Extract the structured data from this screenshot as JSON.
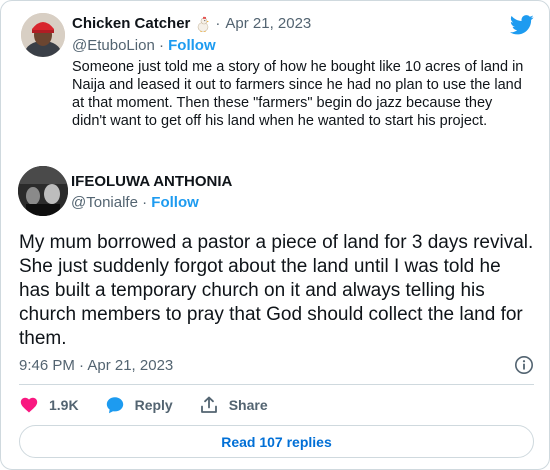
{
  "quoted_tweet": {
    "display_name": "Chicken Catcher",
    "name_emoji": "chicken-emoji",
    "separator": "·",
    "date": "Apr 21, 2023",
    "handle": "@EtuboLion",
    "handle_separator": "·",
    "follow_label": "Follow",
    "text": "Someone just told me a story of how he bought like 10 acres of land in Naija and leased it out to farmers since he had no plan to use the land at that moment. Then these \"farmers\" begin do jazz because they didn't want to get off his land when he wanted to start his project."
  },
  "tweet": {
    "display_name": "IFEOLUWA ANTHONIA",
    "handle": "@Tonialfe",
    "handle_separator": "·",
    "follow_label": "Follow",
    "text": "My mum borrowed a pastor a piece of land for 3 days revival. She just suddenly forgot about the land until I was told he has built a temporary church on it and always telling his church members to pray that God should collect the land for them.",
    "timestamp": "9:46 PM · Apr 21, 2023"
  },
  "actions": {
    "like_count": "1.9K",
    "reply_label": "Reply",
    "share_label": "Share"
  },
  "read_replies_label": "Read 107 replies",
  "colors": {
    "brand_blue": "#1d9bf0",
    "like_pink": "#f91880",
    "secondary_text": "#536471",
    "border": "#cfd9de"
  },
  "icons": {
    "logo": "twitter-bird-icon",
    "info": "info-icon",
    "like": "heart-icon",
    "reply": "speech-bubble-icon",
    "share": "share-upload-icon"
  }
}
